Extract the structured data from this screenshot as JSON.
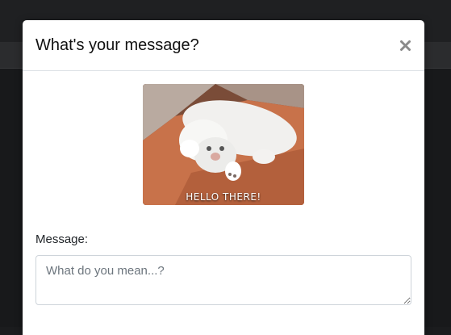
{
  "modal": {
    "title": "What's your message?",
    "close_icon": "close-icon",
    "gif": {
      "caption": "HELLO THERE!"
    },
    "message_label": "Message:",
    "message_placeholder": "What do you mean...?",
    "message_value": ""
  },
  "colors": {
    "backdrop": "#18191b",
    "modal_bg": "#ffffff",
    "border": "#ced4da",
    "placeholder": "#6c757d"
  }
}
